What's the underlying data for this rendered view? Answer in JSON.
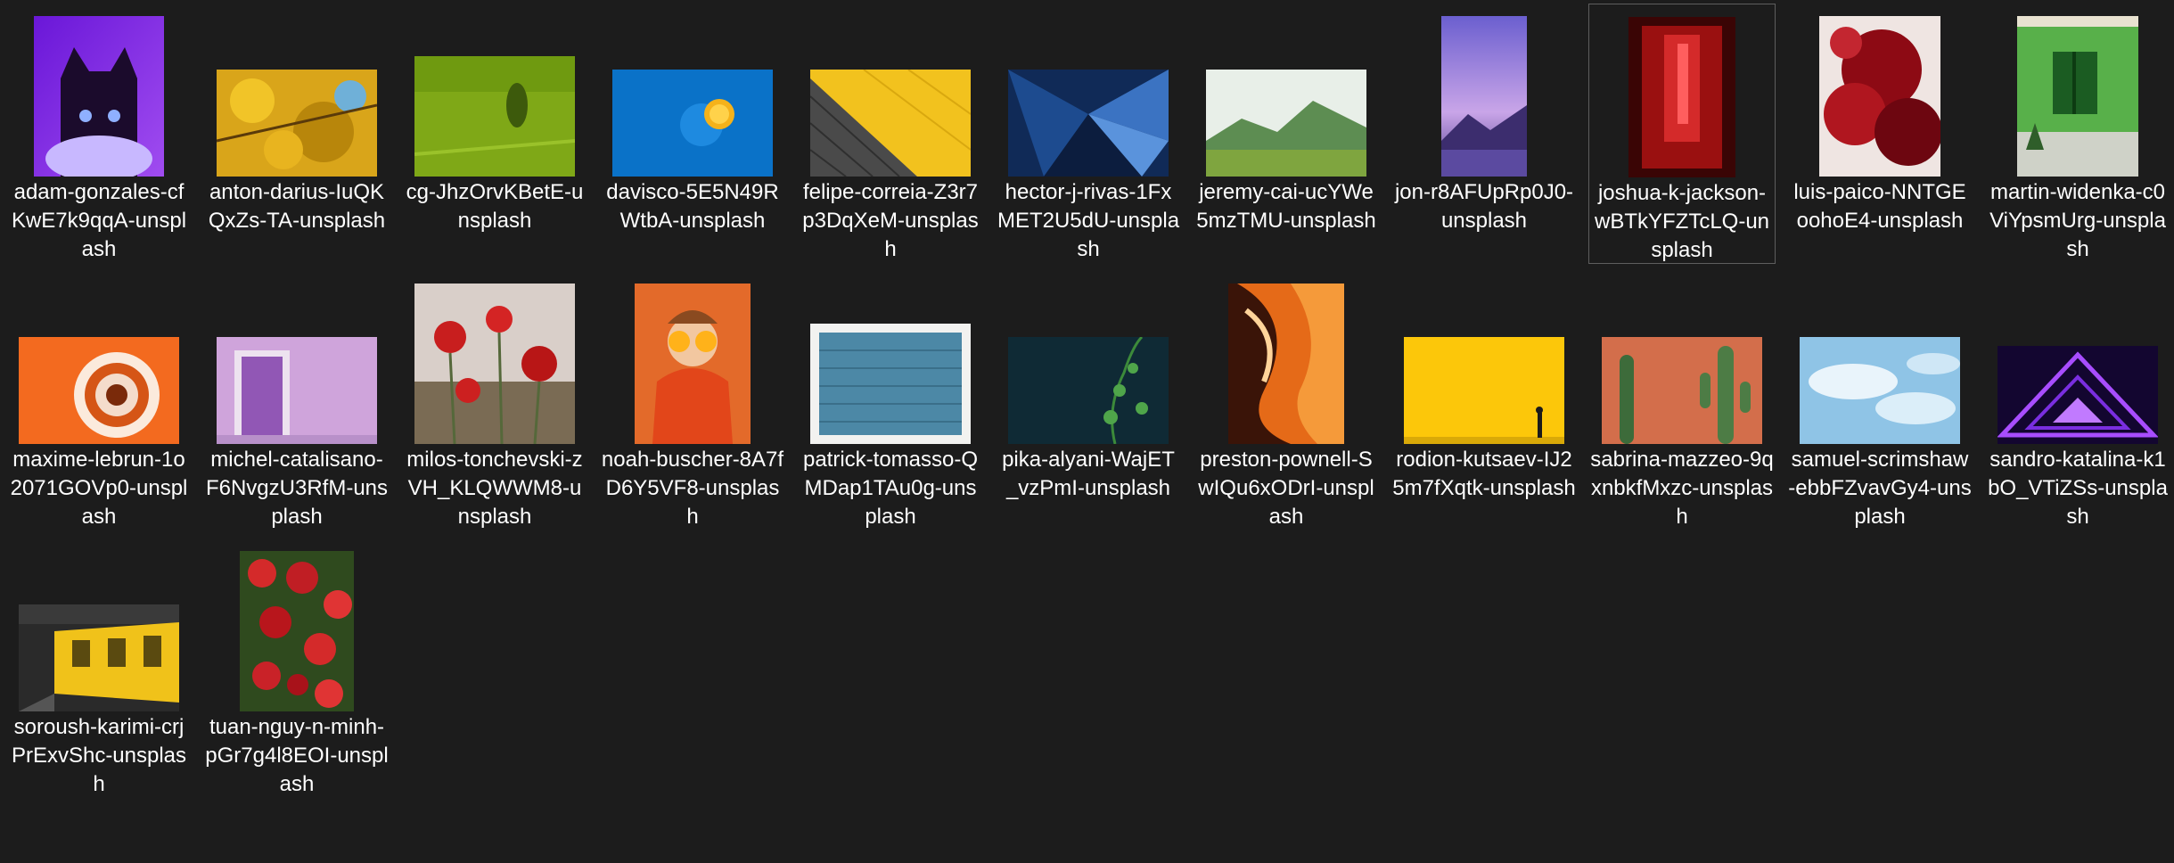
{
  "window": {
    "background": "#1c1c1c"
  },
  "files": [
    {
      "name": "adam-gonzales-cfKwE7k9qqA-unsplash",
      "thumbnail": "purple-cat"
    },
    {
      "name": "anton-darius-IuQKQxZs-TA-unsplash",
      "thumbnail": "yellow-foliage"
    },
    {
      "name": "cg-JhzOrvKBetE-unsplash",
      "thumbnail": "green-field"
    },
    {
      "name": "davisco-5E5N49RWtbA-unsplash",
      "thumbnail": "blue-lemon"
    },
    {
      "name": "felipe-correia-Z3r7p3DqXeM-unsplash",
      "thumbnail": "yellow-pavement"
    },
    {
      "name": "hector-j-rivas-1FxMET2U5dU-unsplash",
      "thumbnail": "blue-geometric"
    },
    {
      "name": "jeremy-cai-ucYWe5mzTMU-unsplash",
      "thumbnail": "green-hills"
    },
    {
      "name": "jon-r8AFUpRp0J0-unsplash",
      "thumbnail": "purple-mountain"
    },
    {
      "name": "joshua-k-jackson-wBTkYFZTcLQ-unsplash",
      "thumbnail": "red-light",
      "selected": true
    },
    {
      "name": "luis-paico-NNTGEoohoE4-unsplash",
      "thumbnail": "red-flowers-tree"
    },
    {
      "name": "martin-widenka-c0ViYpsmUrg-unsplash",
      "thumbnail": "green-house"
    },
    {
      "name": "maxime-lebrun-1o2071GOVp0-unsplash",
      "thumbnail": "orange-spiral"
    },
    {
      "name": "michel-catalisano-F6NvgzU3RfM-unsplash",
      "thumbnail": "lilac-door"
    },
    {
      "name": "milos-tonchevski-zVH_KLQWWM8-unsplash",
      "thumbnail": "poppies"
    },
    {
      "name": "noah-buscher-8A7fD6Y5VF8-unsplash",
      "thumbnail": "orange-person"
    },
    {
      "name": "patrick-tomasso-QMDap1TAu0g-unsplash",
      "thumbnail": "blue-bricks"
    },
    {
      "name": "pika-alyani-WajET_vzPmI-unsplash",
      "thumbnail": "dark-plant"
    },
    {
      "name": "preston-pownell-SwIQu6xODrI-unsplash",
      "thumbnail": "orange-canyon"
    },
    {
      "name": "rodion-kutsaev-IJ25m7fXqtk-unsplash",
      "thumbnail": "yellow-wall"
    },
    {
      "name": "sabrina-mazzeo-9qxnbkfMxzc-unsplash",
      "thumbnail": "cactus-wall"
    },
    {
      "name": "samuel-scrimshaw-ebbFZvavGy4-unsplash",
      "thumbnail": "blue-sky"
    },
    {
      "name": "sandro-katalina-k1bO_VTiZSs-unsplash",
      "thumbnail": "neon-tunnel"
    },
    {
      "name": "soroush-karimi-crjPrExvShc-unsplash",
      "thumbnail": "yellow-train"
    },
    {
      "name": "tuan-nguy-n-minh-pGr7g4l8EOI-unsplash",
      "thumbnail": "red-flower-field"
    }
  ]
}
